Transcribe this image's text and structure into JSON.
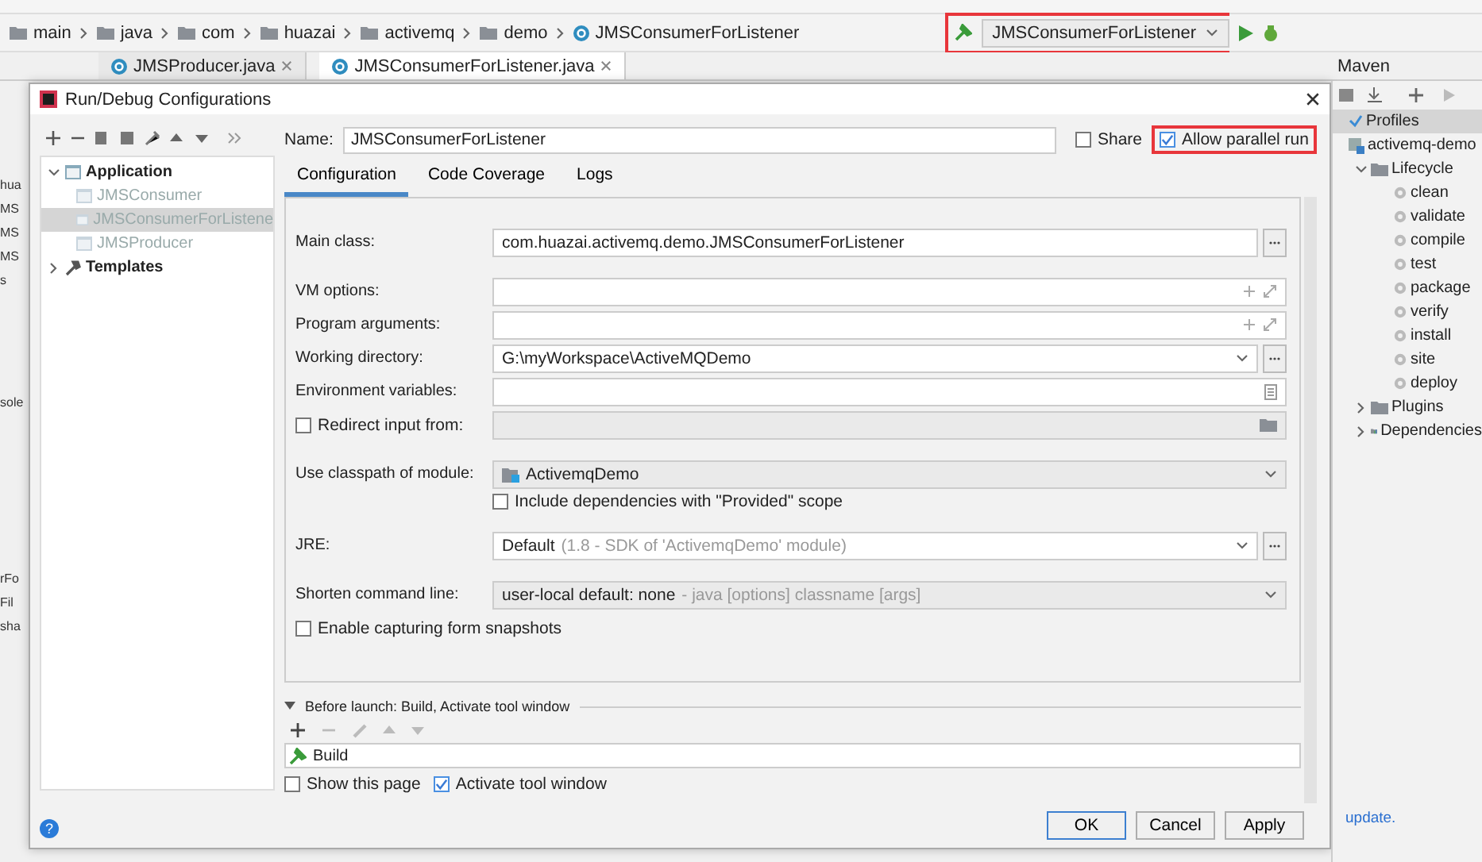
{
  "breadcrumbs": [
    "main",
    "java",
    "com",
    "huazai",
    "activemq",
    "demo",
    "JMSConsumerForListener"
  ],
  "run_config": "JMSConsumerForListener",
  "editor_tabs": [
    {
      "label": "JMSProducer.java",
      "selected": false
    },
    {
      "label": "JMSConsumerForListener.java",
      "selected": true
    }
  ],
  "left_edge": [
    [
      "hua",
      "MS",
      "MS",
      "MS",
      "s"
    ],
    [
      "sole"
    ],
    [
      "rFo",
      "Fil",
      "sha"
    ]
  ],
  "maven": {
    "title": "Maven",
    "items": [
      {
        "label": "Profiles",
        "kind": "profiles",
        "selected": true
      },
      {
        "label": "activemq-demo",
        "kind": "project",
        "selected": false,
        "children": [
          {
            "label": "Lifecycle",
            "kind": "folder",
            "selected": false,
            "expanded": true,
            "children": [
              {
                "label": "clean",
                "kind": "goal",
                "selected": false
              },
              {
                "label": "validate",
                "kind": "goal",
                "selected": false
              },
              {
                "label": "compile",
                "kind": "goal",
                "selected": false
              },
              {
                "label": "test",
                "kind": "goal",
                "selected": false
              },
              {
                "label": "package",
                "kind": "goal",
                "selected": false
              },
              {
                "label": "verify",
                "kind": "goal",
                "selected": false
              },
              {
                "label": "install",
                "kind": "goal",
                "selected": false
              },
              {
                "label": "site",
                "kind": "goal",
                "selected": false
              },
              {
                "label": "deploy",
                "kind": "goal",
                "selected": false
              }
            ]
          },
          {
            "label": "Plugins",
            "kind": "folder",
            "selected": false,
            "expanded": false
          },
          {
            "label": "Dependencies",
            "kind": "deps",
            "selected": false,
            "expanded": false
          }
        ]
      }
    ],
    "footer": "update."
  },
  "dialog": {
    "title": "Run/Debug Configurations",
    "tree": [
      {
        "label": "Application",
        "kind": "group",
        "expanded": true,
        "children": [
          {
            "label": "JMSConsumer",
            "kind": "config",
            "selected": false
          },
          {
            "label": "JMSConsumerForListene",
            "kind": "config",
            "selected": true
          },
          {
            "label": "JMSProducer",
            "kind": "config",
            "selected": false
          }
        ]
      },
      {
        "label": "Templates",
        "kind": "templates",
        "expanded": false
      }
    ],
    "name_label": "Name:",
    "name_value": "JMSConsumerForListener",
    "share": {
      "label": "Share",
      "checked": false
    },
    "parallel": {
      "label": "Allow parallel run",
      "checked": true
    },
    "tabs": [
      {
        "label": "Configuration",
        "selected": true
      },
      {
        "label": "Code Coverage",
        "selected": false
      },
      {
        "label": "Logs",
        "selected": false
      }
    ],
    "sections": [
      [
        {
          "kind": "browse_input",
          "label": "Main class:",
          "value": "com.huazai.activemq.demo.JMSConsumerForListener"
        }
      ],
      [
        {
          "kind": "expand_input",
          "label": "VM options:"
        },
        {
          "kind": "expand_input",
          "label": "Program arguments:"
        },
        {
          "kind": "browse_combo",
          "label": "Working directory:",
          "value": "G:\\myWorkspace\\ActiveMQDemo"
        },
        {
          "kind": "env_input",
          "label": "Environment variables:"
        },
        {
          "kind": "redirect",
          "label": "Redirect input from:",
          "checked": false,
          "disabled": true
        }
      ],
      [
        {
          "kind": "module_combo",
          "label": "Use classpath of module:",
          "value": "ActivemqDemo",
          "disabled": true
        },
        {
          "kind": "sub_checkbox",
          "label": "Include dependencies with \"Provided\" scope",
          "checked": false
        }
      ],
      [
        {
          "kind": "browse_combo",
          "label": "JRE:",
          "value": "Default",
          "hint": "(1.8 - SDK of 'ActivemqDemo' module)"
        }
      ],
      [
        {
          "kind": "combo",
          "label": "Shorten command line:",
          "value": "user-local default: none",
          "hint": "- java [options] classname [args]",
          "disabled": true
        },
        {
          "kind": "checkbox",
          "label": "Enable capturing form snapshots",
          "checked": false
        }
      ]
    ],
    "before_launch": {
      "title": "Before launch: Build, Activate tool window",
      "expanded": true,
      "tasks": [
        "Build"
      ],
      "options": [
        {
          "label": "Show this page",
          "checked": false
        },
        {
          "label": "Activate tool window",
          "checked": true
        }
      ]
    },
    "help": "?",
    "buttons": [
      {
        "label": "OK",
        "kind": "default"
      },
      {
        "label": "Cancel",
        "kind": "normal"
      },
      {
        "label": "Apply",
        "kind": "normal"
      }
    ]
  }
}
